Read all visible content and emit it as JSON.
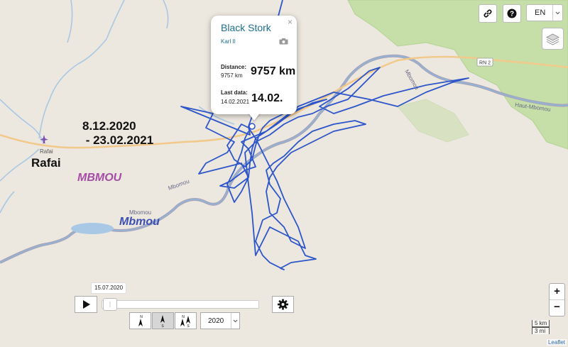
{
  "map": {
    "date_range_line1": "8.12.2020",
    "date_range_line2": " - 23.02.2021",
    "town_small": "Rafai",
    "town_big": "Rafai",
    "region": "MBMOU",
    "river_big": "Mbmou",
    "river_small_1": "Mbomou",
    "river_small_2": "Mbomou",
    "river_small_3": "Mbomou",
    "road": "RN 2",
    "road_east": "Haut-Mbomou",
    "track_color": "#2c55c9"
  },
  "popup": {
    "title": "Black Stork",
    "subtitle": "Karl II",
    "distance_label": "Distance:",
    "distance_small": "9757 km",
    "distance_big": "9757 km",
    "lastdata_label": "Last data:",
    "lastdata_small": "14.02.2021",
    "lastdata_big": "14.02.",
    "close": "×"
  },
  "controls": {
    "language": "EN",
    "slider_date": "15.07.2020",
    "year": "2020",
    "zoom_in": "+",
    "zoom_out": "−",
    "scale_km": "5 km",
    "scale_mi": "3 mi",
    "attribution": "Leaflet"
  }
}
